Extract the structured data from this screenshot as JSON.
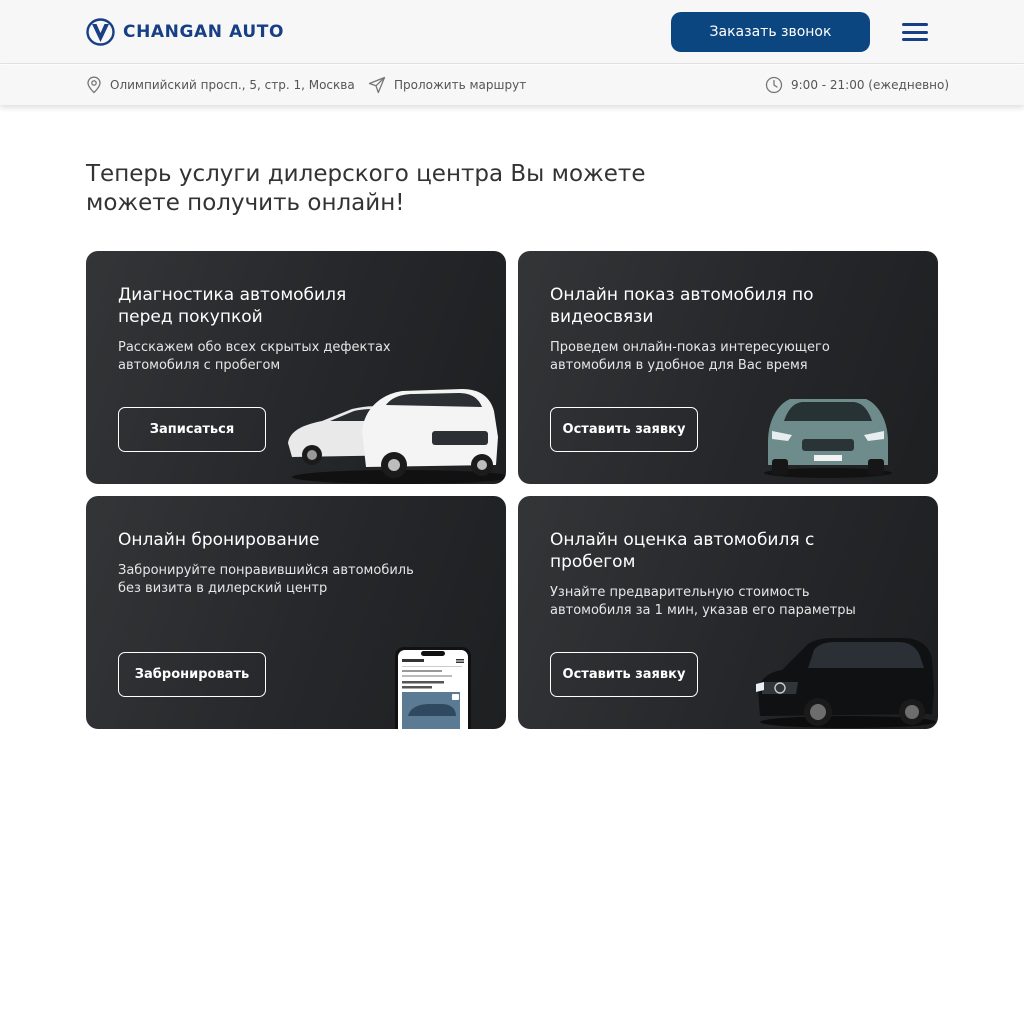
{
  "header": {
    "brand": "CHANGAN AUTO",
    "call_button": "Заказать звонок",
    "brand_color": "#173f86",
    "button_color": "#0c4680"
  },
  "infobar": {
    "address": "Олимпийский просп., 5, стр. 1, Москва",
    "route": "Проложить маршрут",
    "hours": "9:00 - 21:00 (ежедневно)",
    "icons": [
      "location-pin-icon",
      "send-arrow-icon",
      "clock-icon"
    ]
  },
  "main": {
    "headline_line1": "Теперь услуги дилерского центра Вы можете",
    "headline_line2": "можете получить онлайн!",
    "cards": [
      {
        "title_line1": "Диагностика автомобиля",
        "title_line2": "перед покупкой",
        "desc_line1": "Расскажем обо всех скрытых дефектах",
        "desc_line2": "автомобиля с пробегом",
        "button": "Записаться"
      },
      {
        "title_line1": "Онлайн показ автомобиля по",
        "title_line2": "видеосвязи",
        "desc_line1": "Проведем онлайн-показ интересующего",
        "desc_line2": "автомобиля в удобное для Вас время",
        "button": "Оставить заявку"
      },
      {
        "title_line1": "Онлайн бронирование",
        "title_line2": "",
        "desc_line1": "Забронируйте понравившийся автомобиль",
        "desc_line2": "без визита в дилерский центр",
        "button": "Забронировать"
      },
      {
        "title_line1": "Онлайн оценка автомобиля с",
        "title_line2": "пробегом",
        "desc_line1": "Узнайте предварительную стоимость",
        "desc_line2": "автомобиля за 1 мин, указав его параметры",
        "button": "Оставить заявку"
      }
    ]
  }
}
